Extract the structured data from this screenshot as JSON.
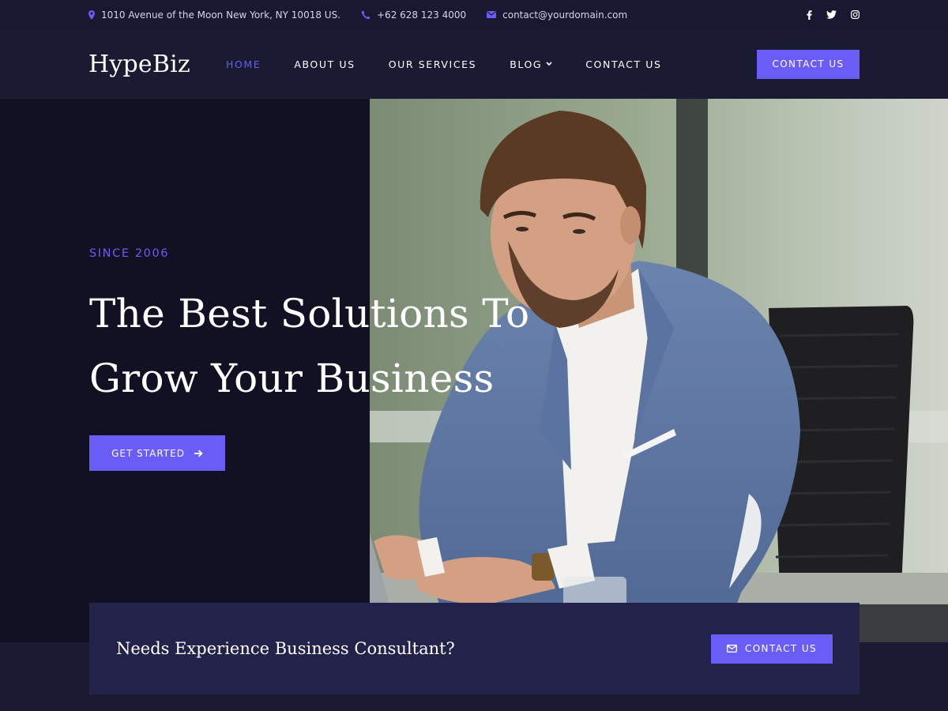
{
  "topbar": {
    "address": "1010 Avenue of the Moon New York, NY 10018 US.",
    "phone": "+62 628 123 4000",
    "email": "contact@yourdomain.com",
    "social_icons": [
      "facebook-icon",
      "twitter-icon",
      "instagram-icon"
    ]
  },
  "header": {
    "logo": "HypeBiz",
    "nav": [
      {
        "label": "HOME",
        "active": true
      },
      {
        "label": "ABOUT US"
      },
      {
        "label": "OUR SERVICES"
      },
      {
        "label": "BLOG",
        "dropdown": true
      },
      {
        "label": "CONTACT US"
      }
    ],
    "cta_label": "CONTACT US"
  },
  "hero": {
    "eyebrow": "SINCE 2006",
    "headline_line1": "The Best Solutions To",
    "headline_line2": "Grow Your Business",
    "button_label": "GET STARTED"
  },
  "cta_band": {
    "text": "Needs Experience Business Consultant?",
    "button_label": "CONTACT US"
  },
  "colors": {
    "accent": "#6a5cf6",
    "background_dark": "#121124",
    "header_bg": "#1b1a33",
    "cta_box_bg": "#23224a"
  }
}
